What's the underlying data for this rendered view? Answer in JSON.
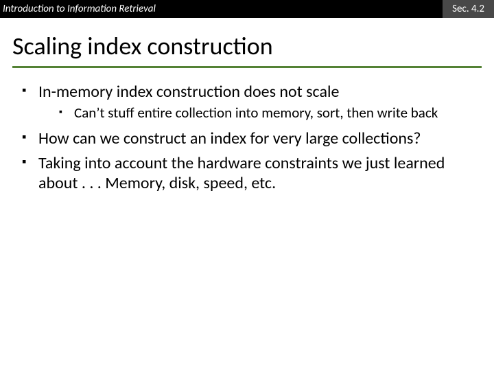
{
  "header": {
    "left": "Introduction to Information Retrieval",
    "right": "Sec. 4.2"
  },
  "title": "Scaling index construction",
  "bullets": {
    "b1": "In-memory index construction does not scale",
    "b1_1": "Can’t stuff entire collection into memory, sort, then write back",
    "b2": "How can we construct an index for very large collections?",
    "b3": "Taking into account the hardware constraints we just learned about . . . Memory, disk, speed, etc."
  }
}
